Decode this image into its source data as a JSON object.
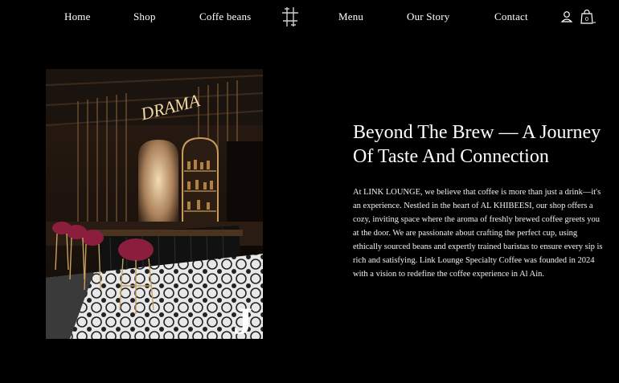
{
  "nav": {
    "home": "Home",
    "shop": "Shop",
    "coffee_beans": "Coffe beans",
    "menu": "Menu",
    "our_story": "Our Story",
    "contact": "Contact",
    "logo_icon": "link-lounge-logo",
    "account_icon": "user-icon",
    "cart_icon": "shopping-bag-icon",
    "cart_count": "0"
  },
  "hero": {
    "image_sign_text": "DRAMA",
    "image_corner_letter": "J",
    "headline": "Beyond The Brew — A Journey Of Taste And Connection",
    "body": "At LINK LOUNGE, we believe that coffee is more than just a drink—it's an experience. Nestled in the heart of AL KHIBEESI, our shop offers a cozy, inviting space where the aroma of freshly brewed coffee greets you at the door. We are passionate about crafting the perfect cup, using ethically sourced beans and expertly trained baristas to ensure every sip is rich and satisfying. Link Lounge Specialty Coffee was founded in 2024 with a vision to redefine the coffee experience in Al Ain."
  },
  "colors": {
    "background": "#000000",
    "text": "#ffffff",
    "stool": "#8a1e3c",
    "warm_light": "#e0a860"
  }
}
